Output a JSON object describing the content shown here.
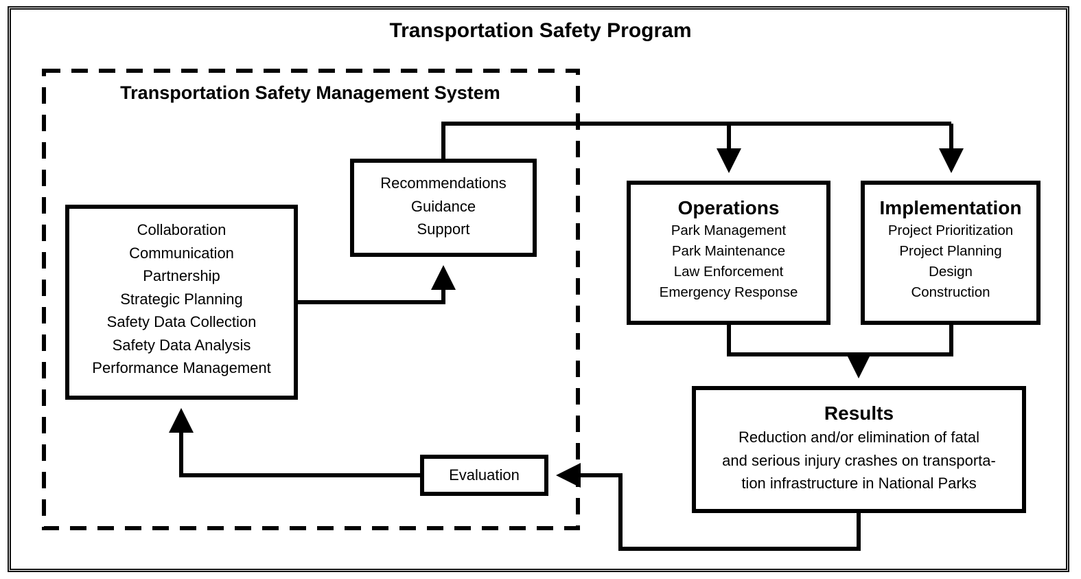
{
  "title": "Transportation Safety Program",
  "tsms": {
    "title": "Transportation Safety Management System"
  },
  "core_box": {
    "items": [
      "Collaboration",
      "Communication",
      "Partnership",
      "Strategic Planning",
      "Safety Data Collection",
      "Safety Data Analysis",
      "Performance Management"
    ]
  },
  "recommendations_box": {
    "items": [
      "Recommendations",
      "Guidance",
      "Support"
    ]
  },
  "operations_box": {
    "title": "Operations",
    "items": [
      "Park Management",
      "Park Maintenance",
      "Law Enforcement",
      "Emergency Response"
    ]
  },
  "implementation_box": {
    "title": "Implementation",
    "items": [
      "Project Prioritization",
      "Project Planning",
      "Design",
      "Construction"
    ]
  },
  "results_box": {
    "title": "Results",
    "items": [
      "Reduction and/or elimination of fatal",
      "and serious injury crashes on transporta-",
      "tion infrastructure in National Parks"
    ]
  },
  "evaluation_box": {
    "label": "Evaluation"
  },
  "connections": [
    {
      "from": "core_box",
      "to": "recommendations_box"
    },
    {
      "from": "recommendations_box",
      "to": "operations_box"
    },
    {
      "from": "recommendations_box",
      "to": "implementation_box"
    },
    {
      "from": "operations_box",
      "to": "results_box"
    },
    {
      "from": "implementation_box",
      "to": "results_box"
    },
    {
      "from": "results_box",
      "to": "evaluation_box"
    },
    {
      "from": "evaluation_box",
      "to": "core_box"
    }
  ]
}
